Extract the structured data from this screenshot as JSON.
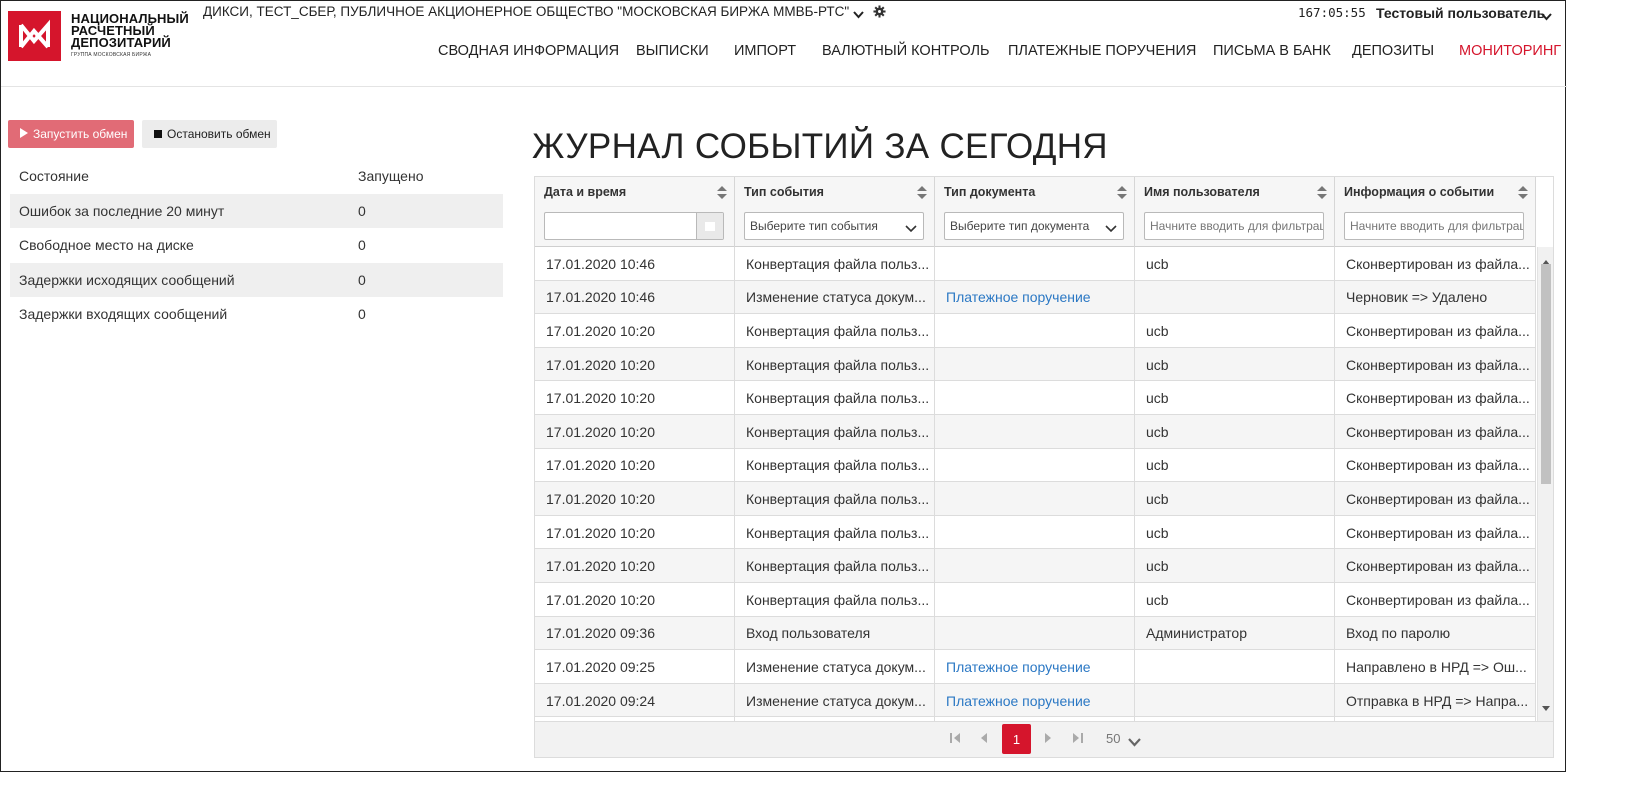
{
  "header": {
    "logo_lines": [
      "НАЦИОНАЛЬНЫЙ",
      "РАСЧЕТНЫЙ",
      "ДЕПОЗИТАРИЙ"
    ],
    "logo_sub": "ГРУППА МОСКОВСКАЯ БИРЖА",
    "organization": "ДИКСИ, ТЕСТ_СБЕР, ПУБЛИЧНОЕ АКЦИОНЕРНОЕ ОБЩЕСТВО \"МОСКОВСКАЯ БИРЖА ММВБ-РТС\"",
    "clock": "167:05:55",
    "user_name": "Тестовый пользователь",
    "nav": [
      {
        "label": "СВОДНАЯ ИНФОРМАЦИЯ"
      },
      {
        "label": "ВЫПИСКИ"
      },
      {
        "label": "ИМПОРТ"
      },
      {
        "label": "ВАЛЮТНЫЙ КОНТРОЛЬ"
      },
      {
        "label": "ПЛАТЕЖНЫЕ ПОРУЧЕНИЯ"
      },
      {
        "label": "ПИСЬМА В БАНК"
      },
      {
        "label": "ДЕПОЗИТЫ"
      },
      {
        "label": "МОНИТОРИНГ",
        "active": true
      }
    ],
    "accent_color": "#d5152c"
  },
  "controls": {
    "start_label": "Запустить обмен",
    "stop_label": "Остановить обмен"
  },
  "status": {
    "rows": [
      {
        "label": "Состояние",
        "value": "Запущено"
      },
      {
        "label": "Ошибок за последние 20 минут",
        "value": "0"
      },
      {
        "label": "Свободное место на диске",
        "value": "0"
      },
      {
        "label": "Задержки исходящих сообщений",
        "value": "0"
      },
      {
        "label": "Задержки входящих сообщений",
        "value": "0"
      }
    ]
  },
  "journal": {
    "title": "ЖУРНАЛ СОБЫТИЙ ЗА СЕГОДНЯ",
    "columns": [
      "Дата и время",
      "Тип события",
      "Тип документа",
      "Имя пользователя",
      "Информация о событии"
    ],
    "filters": {
      "date_value": "",
      "event_type": "Выберите тип события",
      "doc_type": "Выберите тип документа",
      "user_placeholder": "Начните вводить для фильтрации",
      "info_placeholder": "Начните вводить для фильтрации"
    },
    "rows": [
      [
        "17.01.2020 10:46",
        "Конвертация файла польз...",
        "",
        "ucb",
        "Сконвертирован из файла..."
      ],
      [
        "17.01.2020 10:46",
        "Изменение статуса докум...",
        "Платежное поручение",
        "",
        "Черновик => Удалено"
      ],
      [
        "17.01.2020 10:20",
        "Конвертация файла польз...",
        "",
        "ucb",
        "Сконвертирован из файла..."
      ],
      [
        "17.01.2020 10:20",
        "Конвертация файла польз...",
        "",
        "ucb",
        "Сконвертирован из файла..."
      ],
      [
        "17.01.2020 10:20",
        "Конвертация файла польз...",
        "",
        "ucb",
        "Сконвертирован из файла..."
      ],
      [
        "17.01.2020 10:20",
        "Конвертация файла польз...",
        "",
        "ucb",
        "Сконвертирован из файла..."
      ],
      [
        "17.01.2020 10:20",
        "Конвертация файла польз...",
        "",
        "ucb",
        "Сконвертирован из файла..."
      ],
      [
        "17.01.2020 10:20",
        "Конвертация файла польз...",
        "",
        "ucb",
        "Сконвертирован из файла..."
      ],
      [
        "17.01.2020 10:20",
        "Конвертация файла польз...",
        "",
        "ucb",
        "Сконвертирован из файла..."
      ],
      [
        "17.01.2020 10:20",
        "Конвертация файла польз...",
        "",
        "ucb",
        "Сконвертирован из файла..."
      ],
      [
        "17.01.2020 10:20",
        "Конвертация файла польз...",
        "",
        "ucb",
        "Сконвертирован из файла..."
      ],
      [
        "17.01.2020 09:36",
        "Вход пользователя",
        "",
        "Администратор",
        "Вход по паролю"
      ],
      [
        "17.01.2020 09:25",
        "Изменение статуса докум...",
        "Платежное поручение",
        "",
        "Направлено в НРД => Ош..."
      ],
      [
        "17.01.2020 09:24",
        "Изменение статуса докум...",
        "Платежное поручение",
        "",
        "Отправка в НРД => Напра..."
      ],
      [
        "",
        "",
        "",
        "",
        ""
      ]
    ],
    "pager": {
      "current_page": "1",
      "page_size": "50"
    }
  },
  "icons": [
    "logo-icon",
    "chevron-down-icon",
    "gear-icon",
    "play-icon",
    "stop-icon",
    "sort-icon",
    "calendar-icon",
    "first-page-icon",
    "prev-page-icon",
    "next-page-icon",
    "last-page-icon"
  ]
}
